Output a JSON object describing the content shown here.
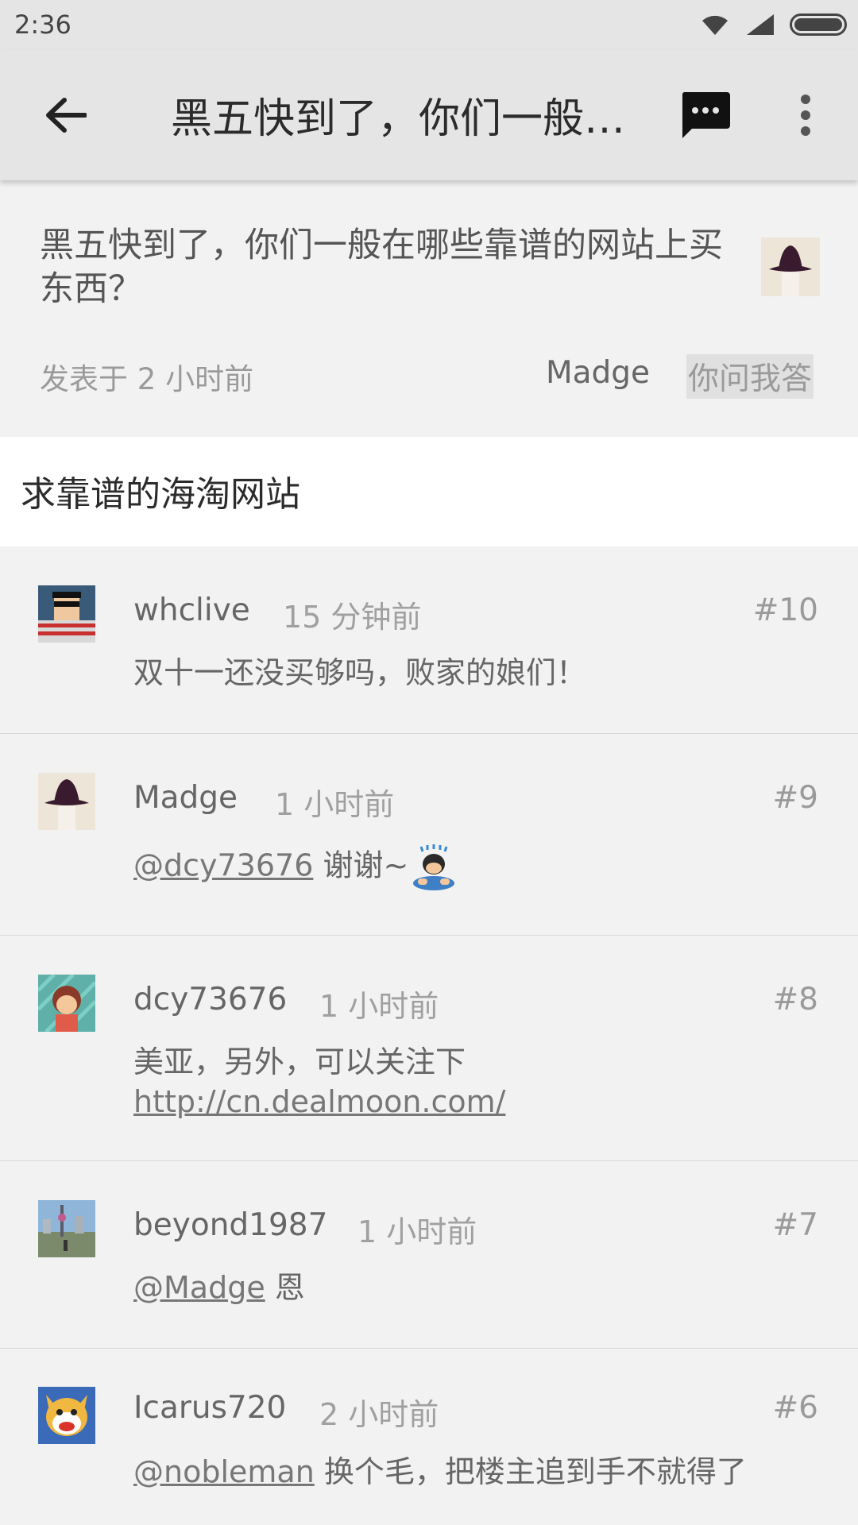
{
  "status": {
    "time": "2:36"
  },
  "toolbar": {
    "title": "黑五快到了，你们一般在哪些靠谱的网站上买东西？",
    "back_icon": "back-arrow-icon",
    "message_icon": "message-icon",
    "more_icon": "more-vert-icon"
  },
  "topic": {
    "title": "黑五快到了，你们一般在哪些靠谱的网站上买东西？",
    "meta": "发表于 2 小时前",
    "author": "Madge",
    "node": "你问我答",
    "content": "求靠谱的海淘网站"
  },
  "replies": [
    {
      "user": "whclive",
      "time": "15 分钟前",
      "floor": "#10",
      "text": "双十一还没买够吗，败家的娘们！"
    },
    {
      "user": "Madge",
      "time": "1 小时前",
      "floor": "#9",
      "mention": "@dcy73676",
      "text": " 谢谢~"
    },
    {
      "user": "dcy73676",
      "time": "1 小时前",
      "floor": "#8",
      "text": "美亚，另外，可以关注下",
      "link": "http://cn.dealmoon.com/"
    },
    {
      "user": "beyond1987",
      "time": "1 小时前",
      "floor": "#7",
      "mention": "@Madge",
      "text": " 恩"
    },
    {
      "user": "Icarus720",
      "time": "2 小时前",
      "floor": "#6",
      "mention": "@nobleman",
      "text": " 换个毛，把楼主追到手不就得了"
    }
  ]
}
